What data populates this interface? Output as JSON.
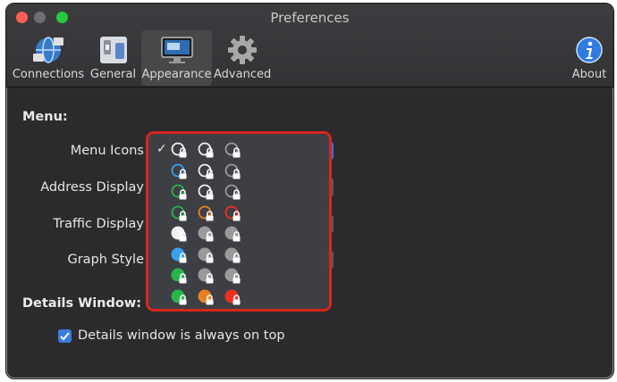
{
  "window": {
    "title": "Preferences"
  },
  "toolbar": [
    {
      "label": "Connections",
      "icon": "connections-globe-icon"
    },
    {
      "label": "General",
      "icon": "general-switch-icon"
    },
    {
      "label": "Appearance",
      "icon": "appearance-monitor-icon",
      "selected": true
    },
    {
      "label": "Advanced",
      "icon": "gear-icon"
    },
    {
      "label": "About",
      "icon": "info-icon"
    }
  ],
  "menu_section": {
    "title": "Menu:",
    "rows": [
      {
        "label": "Menu Icons"
      },
      {
        "label": "Address Display"
      },
      {
        "label": "Traffic Display"
      },
      {
        "label": "Graph Style"
      }
    ]
  },
  "details_section": {
    "title": "Details Window:",
    "checkbox_label": "Details window is always on top",
    "checkbox_checked": true
  },
  "menu_icons_popup": {
    "check_mark": "✓",
    "selected_index": 0,
    "options": [
      {
        "styles": [
          "ring-white",
          "ring-white",
          "ring-grey"
        ]
      },
      {
        "styles": [
          "ring-blue",
          "ring-white",
          "ring-grey"
        ]
      },
      {
        "styles": [
          "ring-green",
          "ring-white",
          "ring-grey"
        ]
      },
      {
        "styles": [
          "ring-green",
          "ring-orange",
          "ring-red"
        ]
      },
      {
        "styles": [
          "solid-white",
          "solid-grey",
          "solid-grey"
        ]
      },
      {
        "styles": [
          "solid-blue",
          "solid-grey",
          "solid-grey"
        ]
      },
      {
        "styles": [
          "solid-green",
          "solid-grey",
          "solid-grey"
        ]
      },
      {
        "styles": [
          "solid-green",
          "solid-orange",
          "solid-red"
        ]
      }
    ]
  },
  "colors": {
    "white": "#f2f2f2",
    "grey": "#9a9a9a",
    "blue": "#3aa0f0",
    "green": "#28b44a",
    "orange": "#e8821e",
    "red": "#f03020",
    "highlight_outline": "#d8261d"
  }
}
